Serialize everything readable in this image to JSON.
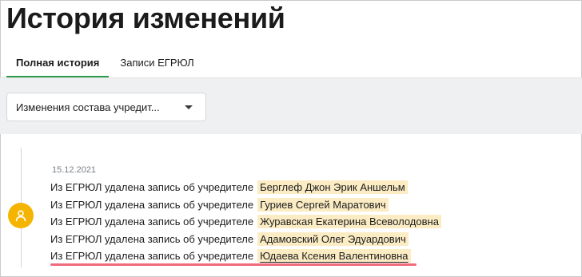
{
  "page": {
    "title": "История изменений"
  },
  "tabs": [
    {
      "label": "Полная история",
      "active": true
    },
    {
      "label": "Записи ЕГРЮЛ",
      "active": false
    }
  ],
  "filter": {
    "selected": "Изменения состава учредит..."
  },
  "timeline": {
    "date": "15.12.2021",
    "icon": "user-icon",
    "entries": [
      {
        "text": "Из ЕГРЮЛ удалена запись об учредителе",
        "name": "Берглеф Джон Эрик Аншельм"
      },
      {
        "text": "Из ЕГРЮЛ удалена запись об учредителе",
        "name": "Гуриев Сергей Маратович"
      },
      {
        "text": "Из ЕГРЮЛ удалена запись об учредителе",
        "name": "Журавская Екатерина Всеволодовна"
      },
      {
        "text": "Из ЕГРЮЛ удалена запись об учредителе",
        "name": "Адамовский Олег Эдуардович"
      },
      {
        "text": "Из ЕГРЮЛ удалена запись об учредителе",
        "name": "Юдаева Ксения Валентиновна"
      }
    ]
  },
  "colors": {
    "accent_green": "#2e9b4a",
    "avatar_yellow": "#f5b400",
    "name_highlight": "#fbecc4",
    "annotation_red": "#f06a7a",
    "filter_band": "#eef0f2"
  }
}
